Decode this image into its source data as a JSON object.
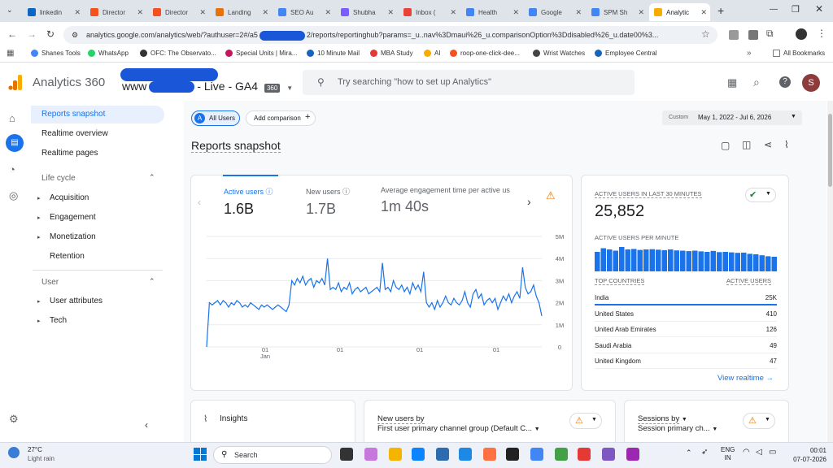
{
  "browser": {
    "tabs": [
      {
        "label": "linkedin",
        "color": "#0a66c2"
      },
      {
        "label": "Director",
        "color": "#f4511e"
      },
      {
        "label": "Director",
        "color": "#f4511e"
      },
      {
        "label": "Landing",
        "color": "#e8710a"
      },
      {
        "label": "SEO Au",
        "color": "#4285f4"
      },
      {
        "label": "Shubha",
        "color": "#7b5cff"
      },
      {
        "label": "Inbox (",
        "color": "#ea4335"
      },
      {
        "label": "Health",
        "color": "#4285f4"
      },
      {
        "label": "Google",
        "color": "#4285f4"
      },
      {
        "label": "SPM Sh",
        "color": "#4285f4"
      },
      {
        "label": "Analytic",
        "color": "#f9ab00"
      }
    ],
    "url": "analytics.google.com/analytics/web/?authuser=2#/a5",
    "url_tail": "2/reports/reportinghub?params=_u..nav%3Dmaui%26_u.comparisonOption%3Ddisabled%26_u.date00%3...",
    "bookmarks": [
      "Shanes Tools",
      "WhatsApp",
      "OFC: The Observato...",
      "Special Units | Mira...",
      "10 Minute Mail",
      "MBA Study",
      "AI",
      "roop-one-click-dee...",
      "Wrist Watches",
      "Employee Central"
    ],
    "all_bookmarks": "All Bookmarks"
  },
  "header": {
    "product": "Analytics 360",
    "property": "www",
    "property_suffix": "- Live - GA4",
    "badge": "360",
    "search_placeholder": "Try searching \"how to set up Analytics\"",
    "avatar": "S"
  },
  "nav": {
    "reports_snapshot": "Reports snapshot",
    "realtime_overview": "Realtime overview",
    "realtime_pages": "Realtime pages",
    "lifecycle": "Life cycle",
    "acquisition": "Acquisition",
    "engagement": "Engagement",
    "monetization": "Monetization",
    "retention": "Retention",
    "user": "User",
    "user_attributes": "User attributes",
    "tech": "Tech"
  },
  "toolbar": {
    "segment_letter": "A",
    "segment": "All Users",
    "add_comparison": "Add comparison",
    "date_prefix": "Custom",
    "date_range": "May 1, 2022 - Jul 6, 2026"
  },
  "page_title": "Reports snapshot",
  "metrics": {
    "active_users_label": "Active users",
    "active_users_value": "1.6B",
    "new_users_label": "New users",
    "new_users_value": "1.7B",
    "engagement_label": "Average engagement time per active us",
    "engagement_value": "1m 40s"
  },
  "chart_data": {
    "type": "line",
    "series": [
      {
        "values": [
          0.0,
          2.0,
          1.9,
          2.0,
          2.1,
          1.9,
          2.1,
          2.0,
          1.8,
          2.0,
          1.9,
          2.1,
          2.0,
          1.8,
          1.9,
          1.8,
          2.0,
          1.9,
          1.8,
          1.7,
          1.9,
          1.8,
          1.9,
          1.8,
          1.7,
          1.8,
          1.9,
          1.8,
          1.7,
          1.6,
          1.9,
          3.0,
          2.8,
          3.1,
          2.9,
          3.2,
          2.8,
          3.0,
          3.1,
          2.7,
          3.0,
          2.9,
          3.1,
          2.8,
          4.0,
          2.6,
          2.7,
          2.6,
          2.9,
          2.5,
          2.7,
          2.6,
          2.9,
          2.4,
          2.6,
          2.7,
          2.5,
          2.6,
          2.7,
          2.4,
          2.5,
          2.6,
          2.7,
          2.5,
          3.8,
          2.6,
          2.7,
          2.5,
          3.0,
          2.7,
          2.6,
          2.8,
          2.5,
          2.7,
          2.4,
          2.9,
          2.6,
          2.8,
          2.5,
          3.4,
          2.0,
          1.8,
          2.0,
          1.7,
          2.1,
          1.8,
          2.0,
          2.3,
          2.0,
          1.9,
          2.2,
          2.0,
          1.9,
          2.1,
          2.5,
          2.0,
          1.8,
          2.4,
          2.6,
          2.2,
          2.4,
          1.9,
          2.1,
          2.2,
          2.0,
          2.2,
          1.7,
          2.0,
          2.3,
          2.1,
          2.4,
          2.0,
          2.3,
          2.5,
          2.2,
          3.6,
          2.7,
          2.4,
          2.5,
          2.8,
          2.3,
          2.0,
          1.4
        ]
      }
    ],
    "x_tick_labels": [
      "01",
      "01",
      "01",
      "01"
    ],
    "x_tick_sublabel": "Jan",
    "y_ticks": [
      "5M",
      "4M",
      "3M",
      "2M",
      "1M",
      "0"
    ],
    "ylim": [
      0,
      5
    ],
    "color": "#1a73e8"
  },
  "realtime": {
    "title": "ACTIVE USERS IN LAST 30 MINUTES",
    "value": "25,852",
    "per_minute_label": "ACTIVE USERS PER MINUTE",
    "per_minute": [
      0.8,
      0.95,
      0.9,
      0.85,
      1.0,
      0.9,
      0.92,
      0.88,
      0.9,
      0.91,
      0.89,
      0.87,
      0.9,
      0.86,
      0.85,
      0.83,
      0.85,
      0.82,
      0.8,
      0.84,
      0.79,
      0.8,
      0.78,
      0.76,
      0.77,
      0.72,
      0.7,
      0.66,
      0.62,
      0.6
    ],
    "top_countries_label": "TOP COUNTRIES",
    "active_users_label": "ACTIVE USERS",
    "countries": [
      {
        "name": "India",
        "value": "25K"
      },
      {
        "name": "United States",
        "value": "410"
      },
      {
        "name": "United Arab Emirates",
        "value": "126"
      },
      {
        "name": "Saudi Arabia",
        "value": "49"
      },
      {
        "name": "United Kingdom",
        "value": "47"
      }
    ],
    "view_realtime": "View realtime"
  },
  "bottom_cards": {
    "insights": "Insights",
    "new_users_by": "New users by",
    "new_users_dim": "First user primary channel group (Default C...",
    "sessions_by": "Sessions by",
    "sessions_dim": "Session primary ch..."
  },
  "taskbar": {
    "weather_temp": "27°C",
    "weather_desc": "Light rain",
    "search": "Search",
    "lang1": "ENG",
    "lang2": "IN",
    "time": "00:01",
    "date": "07-07-2026"
  }
}
